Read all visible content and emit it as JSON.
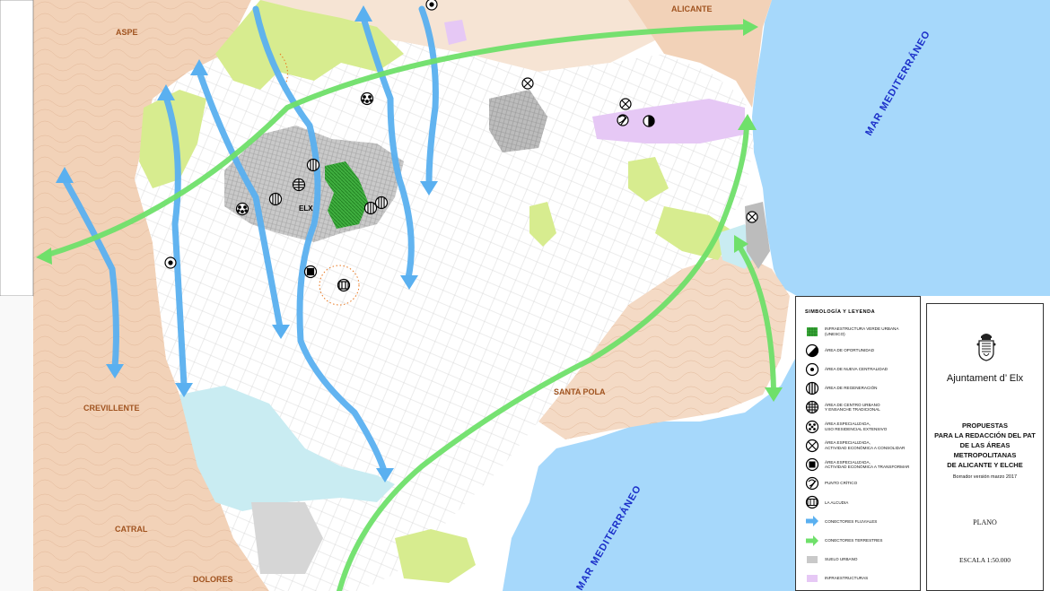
{
  "map": {
    "place_labels": {
      "aspe": "ASPE",
      "alicante": "ALICANTE",
      "crevillente": "CREVILLENTE",
      "santa_pola": "SANTA POLA",
      "catral": "CATRAL",
      "dolores": "DOLORES",
      "elx": "ELX"
    },
    "sea_labels": {
      "north": "MAR  MEDITERRÁNEO",
      "south": "MAR  MEDITERRÁNEO"
    },
    "colors": {
      "sea": "#a6d8fb",
      "mountains": "#f2d2b8",
      "green_areas": "#d7ec8f",
      "urban": "#c9c9c9",
      "fluvial_connectors": "#5ab0f0",
      "terrestrial_connectors": "#6fe06a",
      "infrastructures": "#e6c8f5"
    }
  },
  "legend": {
    "title": "SIMBOLOGÍA  Y  LEYENDA",
    "items": [
      {
        "label": "INFRAESTRUCTURA VERDE URBANA (UNESCO)",
        "icon": "green-hatch-icon"
      },
      {
        "label": "ÁREA DE OPORTUNIDAD",
        "icon": "half-circle-icon"
      },
      {
        "label": "ÁREA DE NUEVA CENTRALIDAD",
        "icon": "dot-circle-icon"
      },
      {
        "label": "ÁREA DE REGENERACIÓN",
        "icon": "vertical-bars-circle-icon"
      },
      {
        "label": "ÁREA DE CENTRO URBANO\nY ENSANCHE TRADICIONAL",
        "icon": "grid-circle-icon"
      },
      {
        "label": "ÁREA ESPECIALIZADA,\nUSO RESIDENCIAL EXTENSIVO",
        "icon": "dotted-circle-icon"
      },
      {
        "label": "ÁREA ESPECIALIZADA,\nACTIVIDAD ECONÓMICA A CONSOLIDAR",
        "icon": "x-circle-icon"
      },
      {
        "label": "ÁREA ESPECIALIZADA,\nACTIVIDAD ECONÓMICA A TRANSFORMAR",
        "icon": "square-circle-icon"
      },
      {
        "label": "PUNTO CRÍTICO",
        "icon": "critical-point-icon"
      },
      {
        "label": "LA ALCUDIA",
        "icon": "alcudia-icon"
      },
      {
        "label": "CONECTORES FLUVIALES",
        "icon": "blue-arrow-icon"
      },
      {
        "label": "CONECTORES TERRESTRES",
        "icon": "green-arrow-icon"
      },
      {
        "label": "SUELO URBANO",
        "icon": "grey-swatch-icon"
      },
      {
        "label": "INFRAESTRUCTURAS",
        "icon": "lilac-swatch-icon"
      }
    ]
  },
  "title_block": {
    "org": "Ajuntament d’ Elx",
    "proposal": "PROPUESTAS\nPARA LA REDACCIÓN DEL PAT\nDE LAS ÁREAS METROPOLITANAS\nDE ALICANTE Y ELCHE",
    "draft": "Borrador versión marzo 2017",
    "plan": "PLANO",
    "scale": "ESCALA 1:50.000"
  }
}
